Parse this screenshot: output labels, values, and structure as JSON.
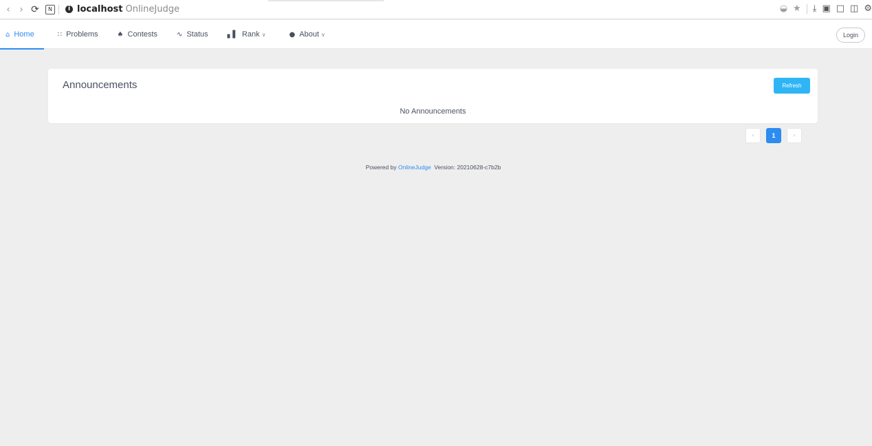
{
  "browser": {
    "host": "localhost",
    "page_title": "OnlineJudge",
    "reader_mode_label": "N"
  },
  "nav": {
    "items": [
      {
        "label": "Home",
        "icon": "home-icon",
        "active": true,
        "dropdown": false
      },
      {
        "label": "Problems",
        "icon": "grid-icon",
        "active": false,
        "dropdown": false
      },
      {
        "label": "Contests",
        "icon": "trophy-icon",
        "active": false,
        "dropdown": false
      },
      {
        "label": "Status",
        "icon": "pulse-icon",
        "active": false,
        "dropdown": false
      },
      {
        "label": "Rank",
        "icon": "bar-chart-icon",
        "active": false,
        "dropdown": true
      },
      {
        "label": "About",
        "icon": "info-icon",
        "active": false,
        "dropdown": true
      }
    ],
    "login_label": "Login"
  },
  "announcements": {
    "title": "Announcements",
    "refresh_label": "Refresh",
    "empty_text": "No Announcements"
  },
  "pagination": {
    "current_page": "1",
    "prev_symbol": "‹",
    "next_symbol": "›"
  },
  "footer": {
    "powered_prefix": "Powered by",
    "link_text": "OnlineJudge",
    "version_text": "Version: 20210628-c7b2b"
  },
  "colors": {
    "accent": "#2d8cf0",
    "refresh_button": "#2fb5f5",
    "page_background": "#eeeeee"
  }
}
